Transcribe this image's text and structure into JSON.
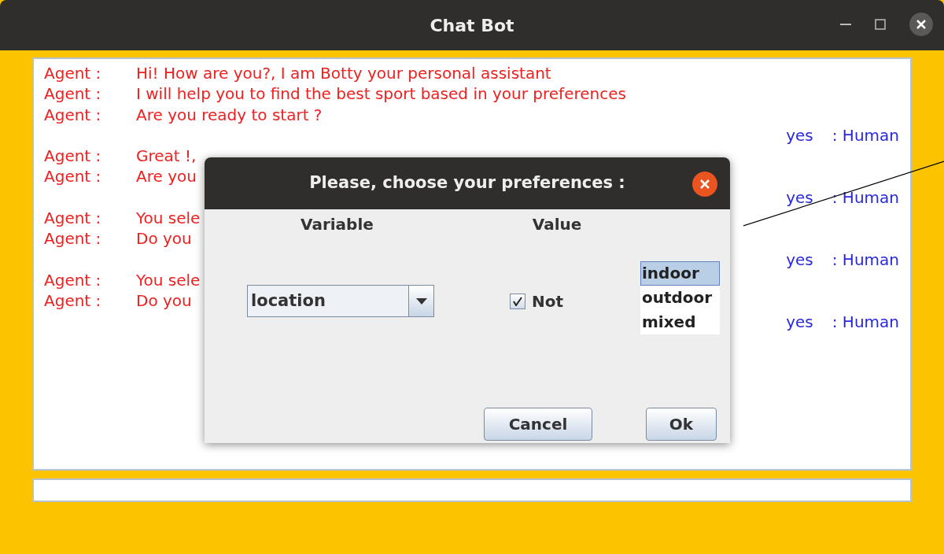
{
  "window": {
    "title": "Chat Bot"
  },
  "messages": [
    {
      "kind": "agent",
      "speaker": "Agent :",
      "text": "Hi! How are you?, I am Botty your personal assistant"
    },
    {
      "kind": "agent",
      "speaker": "Agent :",
      "text": "I will help you to find the best sport based in your preferences"
    },
    {
      "kind": "agent",
      "speaker": "Agent :",
      "text": "Are you ready to start ?"
    },
    {
      "kind": "human",
      "speaker": ": Human",
      "text": "yes"
    },
    {
      "kind": "agent",
      "speaker": "Agent :",
      "text": "Great !,"
    },
    {
      "kind": "agent",
      "speaker": "Agent :",
      "text": "Are you"
    },
    {
      "kind": "human",
      "speaker": ": Human",
      "text": "yes"
    },
    {
      "kind": "agent",
      "speaker": "Agent :",
      "text": "You sele"
    },
    {
      "kind": "agent",
      "speaker": "Agent :",
      "text": "Do you"
    },
    {
      "kind": "human",
      "speaker": ": Human",
      "text": "yes"
    },
    {
      "kind": "agent",
      "speaker": "Agent :",
      "text": "You sele"
    },
    {
      "kind": "agent",
      "speaker": "Agent :",
      "text": "Do you"
    },
    {
      "kind": "human",
      "speaker": ": Human",
      "text": "yes"
    }
  ],
  "dialog": {
    "title": "Please, choose your preferences :",
    "columns": [
      "Variable",
      "Value"
    ],
    "variable": {
      "value": "location"
    },
    "negate": {
      "label": "Not",
      "checked": true
    },
    "values": [
      {
        "label": "indoor",
        "selected": true
      },
      {
        "label": "outdoor",
        "selected": false
      },
      {
        "label": "mixed",
        "selected": false
      }
    ],
    "buttons": [
      "Cancel",
      "Ok"
    ]
  }
}
